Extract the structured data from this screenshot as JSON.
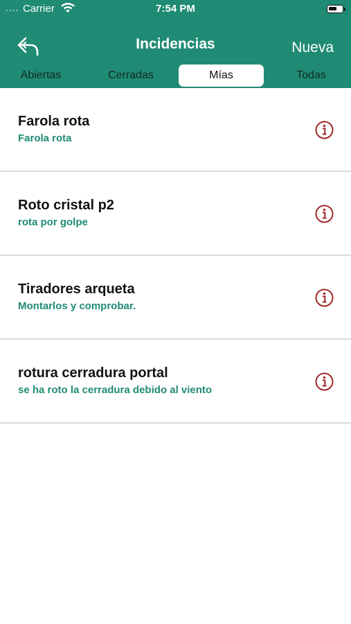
{
  "status_bar": {
    "signal": "....",
    "carrier": "Carrier",
    "time": "7:54 PM"
  },
  "nav": {
    "title": "Incidencias",
    "new_label": "Nueva",
    "back_icon": "reply-arrow-icon"
  },
  "segments": [
    {
      "label": "Abiertas"
    },
    {
      "label": "Cerradas"
    },
    {
      "label": "Mías",
      "selected": true
    },
    {
      "label": "Todas"
    }
  ],
  "items": [
    {
      "title": "Farola rota",
      "subtitle": "Farola rota"
    },
    {
      "title": "Roto cristal p2",
      "subtitle": "rota por golpe"
    },
    {
      "title": "Tiradores arqueta",
      "subtitle": "Montarlos y comprobar."
    },
    {
      "title": "rotura cerradura portal",
      "subtitle": "se ha roto la cerradura debido al viento"
    }
  ],
  "colors": {
    "header": "#208b74",
    "subtitle": "#208b74",
    "info_icon": "#a02828",
    "separator": "#d9d9d9"
  }
}
